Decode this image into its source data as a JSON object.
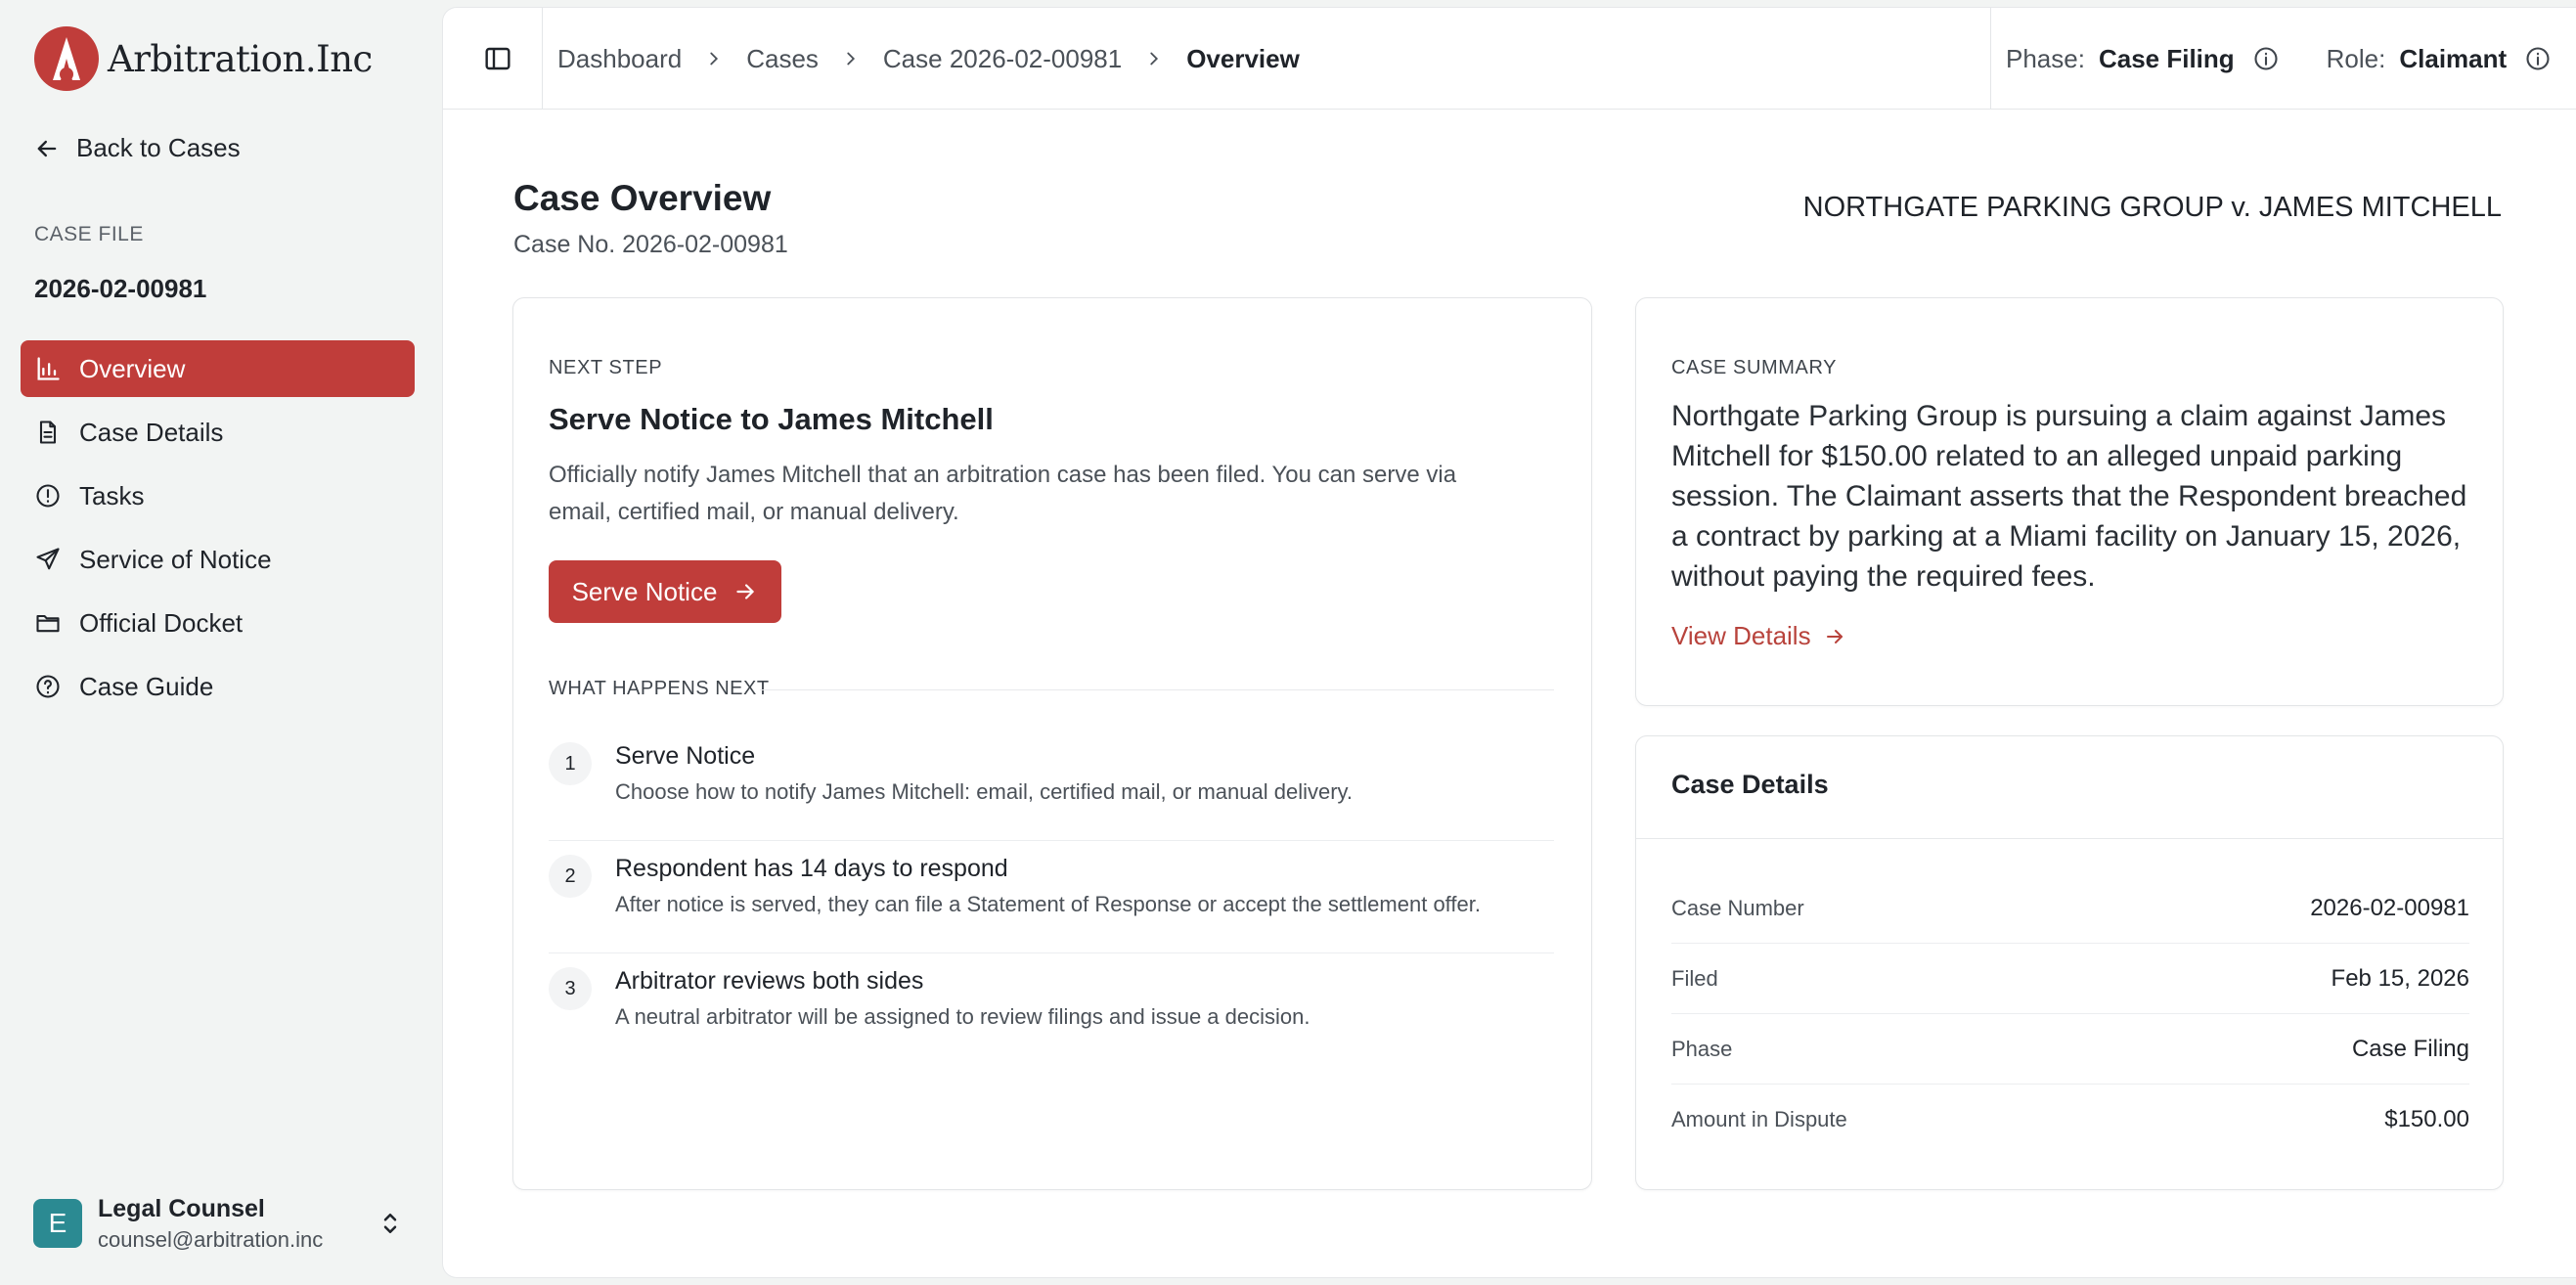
{
  "brand": {
    "name": "Arbitration.Inc",
    "accent": "#c03d3a"
  },
  "sidebar": {
    "back_label": "Back to Cases",
    "case_file_label": "CASE FILE",
    "case_number": "2026-02-00981",
    "items": [
      {
        "label": "Overview",
        "icon": "chart-icon",
        "active": true
      },
      {
        "label": "Case Details",
        "icon": "document-icon",
        "active": false
      },
      {
        "label": "Tasks",
        "icon": "alert-circle-icon",
        "active": false
      },
      {
        "label": "Service of Notice",
        "icon": "send-icon",
        "active": false
      },
      {
        "label": "Official Docket",
        "icon": "folder-icon",
        "active": false
      },
      {
        "label": "Case Guide",
        "icon": "help-circle-icon",
        "active": false
      }
    ],
    "user": {
      "initial": "E",
      "name": "Legal Counsel",
      "email": "counsel@arbitration.inc"
    }
  },
  "topbar": {
    "breadcrumbs": [
      "Dashboard",
      "Cases",
      "Case 2026-02-00981",
      "Overview"
    ],
    "phase_label": "Phase:",
    "phase_value": "Case Filing",
    "role_label": "Role:",
    "role_value": "Claimant"
  },
  "overview": {
    "title": "Case Overview",
    "subtitle": "Case No. 2026-02-00981",
    "parties": "NORTHGATE PARKING GROUP v. JAMES MITCHELL"
  },
  "next_step": {
    "eyebrow": "NEXT STEP",
    "title": "Serve Notice to James Mitchell",
    "description": "Officially notify James Mitchell that an arbitration case has been filed. You can serve via email, certified mail, or manual delivery.",
    "button_label": "Serve Notice",
    "what_next_label": "WHAT HAPPENS NEXT",
    "steps": [
      {
        "num": "1",
        "title": "Serve Notice",
        "desc": "Choose how to notify James Mitchell: email, certified mail, or manual delivery."
      },
      {
        "num": "2",
        "title": "Respondent has 14 days to respond",
        "desc": "After notice is served, they can file a Statement of Response or accept the settlement offer."
      },
      {
        "num": "3",
        "title": "Arbitrator reviews both sides",
        "desc": "A neutral arbitrator will be assigned to review filings and issue a decision."
      }
    ]
  },
  "summary": {
    "eyebrow": "CASE SUMMARY",
    "text": "Northgate Parking Group is pursuing a claim against James Mitchell for $150.00 related to an alleged unpaid parking session. The Claimant asserts that the Respondent breached a contract by parking at a Miami facility on January 15, 2026, without paying the required fees.",
    "link_label": "View Details"
  },
  "details": {
    "title": "Case Details",
    "rows": [
      {
        "label": "Case Number",
        "value": "2026-02-00981"
      },
      {
        "label": "Filed",
        "value": "Feb 15, 2026"
      },
      {
        "label": "Phase",
        "value": "Case Filing"
      },
      {
        "label": "Amount in Dispute",
        "value": "$150.00"
      }
    ]
  }
}
